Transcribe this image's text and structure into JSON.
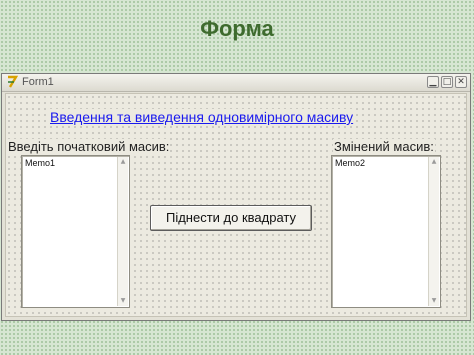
{
  "slide": {
    "title": "Форма"
  },
  "window": {
    "title": "Form1",
    "buttons": {
      "minimize": "▁",
      "maximize": "□",
      "close": "✕"
    }
  },
  "form": {
    "heading": "Введення та виведення одновимірного масиву",
    "input_label": "Введіть початковий масив:",
    "output_label": "Змінений масив:",
    "memo1": "Memo1",
    "memo2": "Memo2",
    "square_button": "Піднести до квадрату"
  },
  "colors": {
    "slide_title": "#3e6b2e",
    "link": "#1a1aee",
    "background": "#d6e6d2"
  }
}
